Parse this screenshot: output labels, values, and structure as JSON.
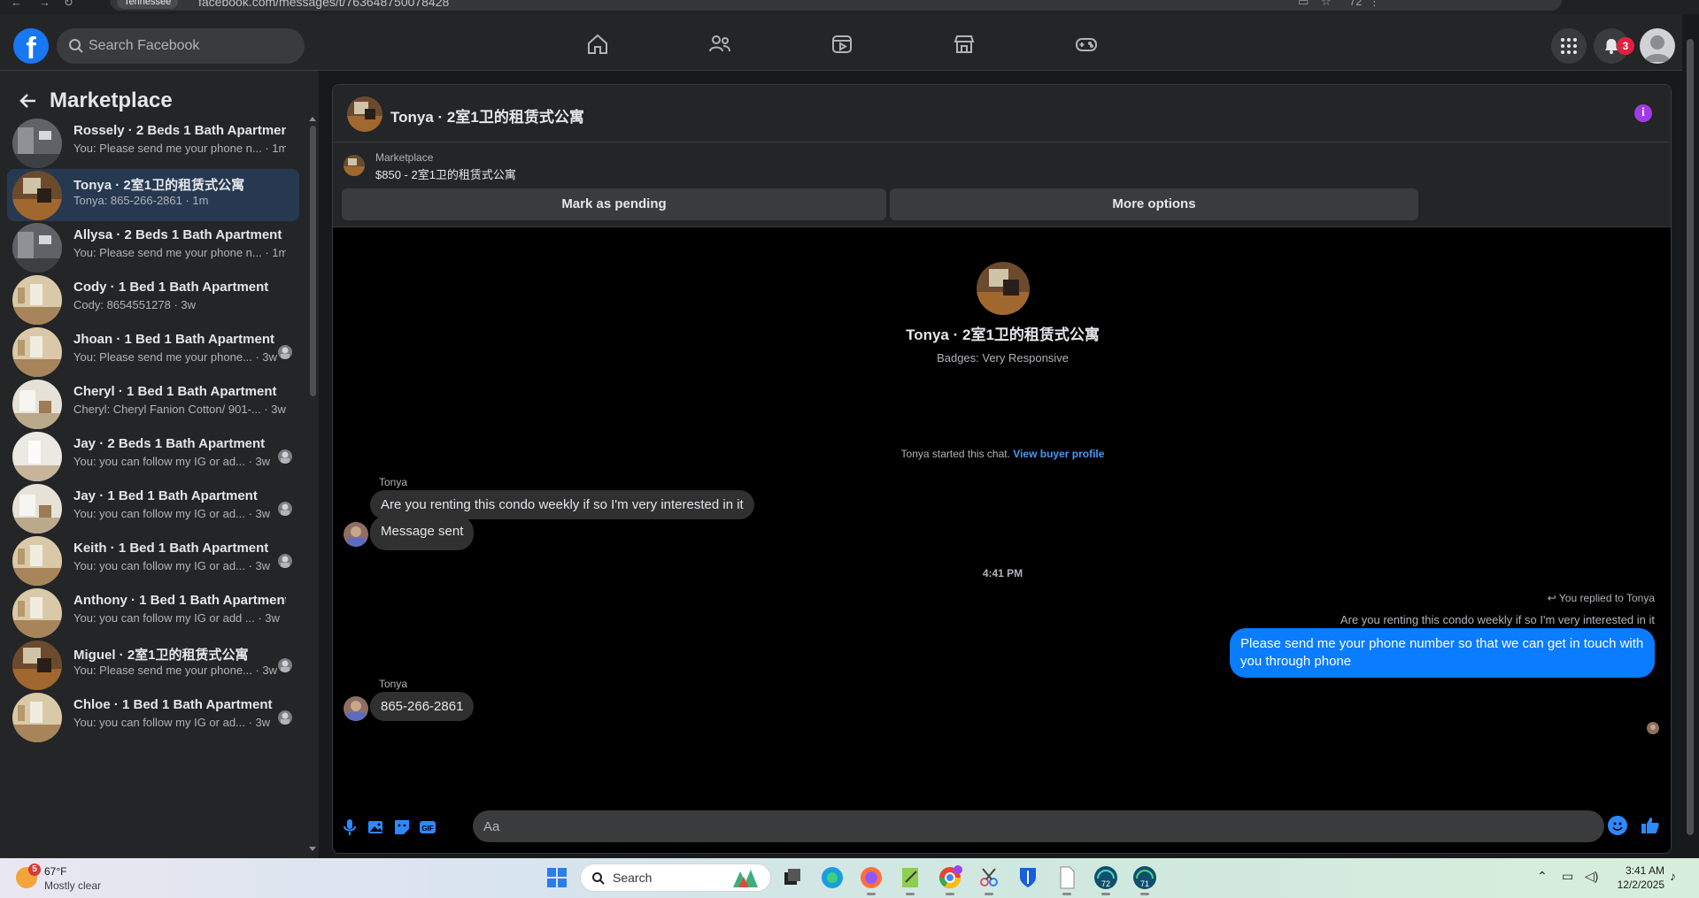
{
  "browser": {
    "location_chip": "Tennessee",
    "url": "facebook.com/messages/t/763648750078428",
    "zoom_hint": "72"
  },
  "topbar": {
    "logo": "f",
    "search_placeholder": "Search Facebook",
    "notification_count": "3",
    "nav_icons": [
      "home-icon",
      "friends-icon",
      "video-icon",
      "marketplace-icon",
      "gaming-icon"
    ]
  },
  "sidebar": {
    "title": "Marketplace",
    "conversations": [
      {
        "name": "Rossely · 2 Beds 1 Bath Apartment",
        "preview": "You: Please send me your phone n... · 1m",
        "thumb": "gray",
        "seen": false,
        "active": false
      },
      {
        "name": "Tonya · 2室1卫的租赁式公寓",
        "preview": "Tonya: 865-266-2861 · 1m",
        "thumb": "wood",
        "seen": false,
        "active": true
      },
      {
        "name": "Allysa · 2 Beds 1 Bath Apartment",
        "preview": "You: Please send me your phone n... · 1m",
        "thumb": "gray",
        "seen": false,
        "active": false
      },
      {
        "name": "Cody · 1 Bed 1 Bath Apartment",
        "preview": "Cody: 8654551278 · 3w",
        "thumb": "room",
        "seen": false,
        "active": false
      },
      {
        "name": "Jhoan · 1 Bed 1 Bath Apartment",
        "preview": "You: Please send me your phone... · 3w",
        "thumb": "room",
        "seen": true,
        "active": false
      },
      {
        "name": "Cheryl · 1 Bed 1 Bath Apartment",
        "preview": "Cheryl: Cheryl Fanion Cotton/ 901-... · 3w",
        "thumb": "bath",
        "seen": false,
        "active": false
      },
      {
        "name": "Jay · 2 Beds 1 Bath Apartment",
        "preview": "You: you can follow my IG or ad... · 3w",
        "thumb": "white",
        "seen": true,
        "active": false
      },
      {
        "name": "Jay · 1 Bed 1 Bath Apartment",
        "preview": "You: you can follow my IG or ad... · 3w",
        "thumb": "bath",
        "seen": true,
        "active": false
      },
      {
        "name": "Keith · 1 Bed 1 Bath Apartment",
        "preview": "You: you can follow my IG or ad... · 3w",
        "thumb": "room",
        "seen": true,
        "active": false
      },
      {
        "name": "Anthony · 1 Bed 1 Bath Apartment",
        "preview": "You: you can follow my IG or add ... · 3w",
        "thumb": "room",
        "seen": false,
        "active": false
      },
      {
        "name": "Miguel · 2室1卫的租赁式公寓",
        "preview": "You: Please send me your phone... · 3w",
        "thumb": "wood",
        "seen": true,
        "active": false
      },
      {
        "name": "Chloe · 1 Bed 1 Bath Apartment",
        "preview": "You: you can follow my IG or ad... · 3w",
        "thumb": "room",
        "seen": true,
        "active": false
      }
    ]
  },
  "chat": {
    "title": "Tonya · 2室1卫的租赁式公寓",
    "marketplace_label": "Marketplace",
    "listing": "$850 - 2室1卫的租赁式公寓",
    "mark_pending": "Mark as pending",
    "more_options": "More options",
    "profile_name": "Tonya · 2室1卫的租赁式公寓",
    "badges": "Badges: Very Responsive",
    "started_text": "Tonya started this chat.",
    "view_profile": "View buyer profile",
    "sender1": "Tonya",
    "msg1": "Are you renting this condo weekly if so I'm very interested in it",
    "msg2": "Message sent",
    "timestamp": "4:41 PM",
    "replied_to": "You replied to Tonya",
    "quoted": "Are you renting this condo weekly if so I'm very interested in it",
    "my_reply": "Please send me your phone  number so that we can get in touch with you through phone",
    "sender2": "Tonya",
    "msg3": "865-266-2861",
    "composer_placeholder": "Aa"
  },
  "taskbar": {
    "weather_badge": "5",
    "temp": "67°F",
    "condition": "Mostly clear",
    "search_label": "Search",
    "time": "3:41 AM",
    "date": "12/2/2025"
  },
  "colors": {
    "accent": "#0a7cff",
    "link": "#4599ff",
    "active_row": "#263951",
    "info": "#a33ae8"
  }
}
